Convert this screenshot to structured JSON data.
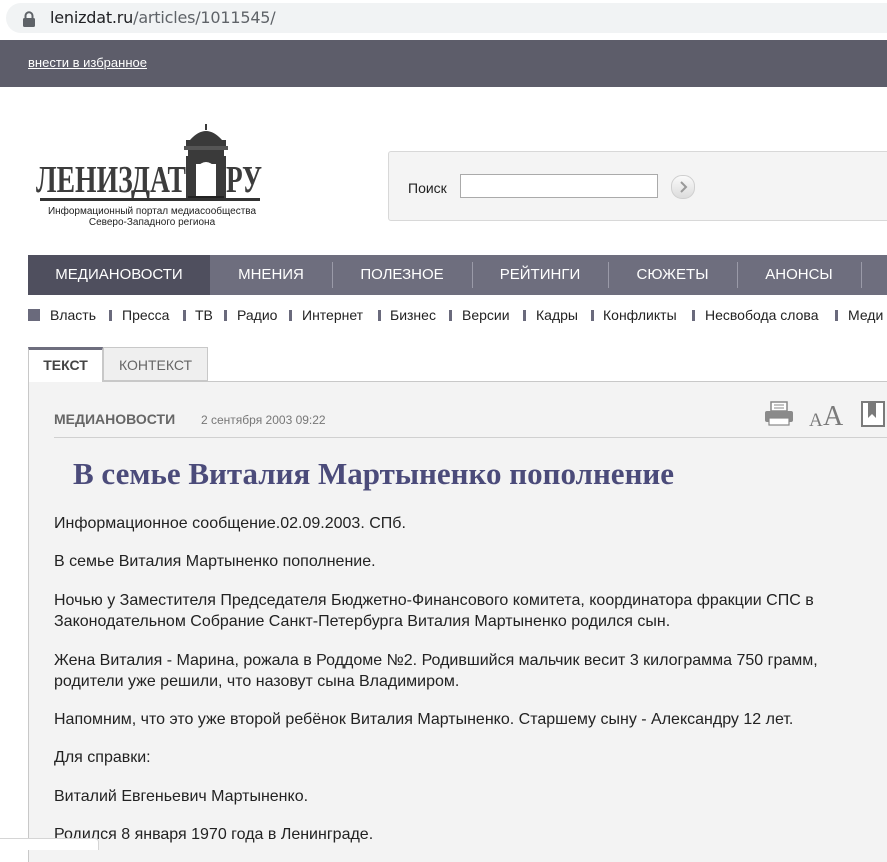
{
  "browser": {
    "url_host": "lenizdat.ru",
    "url_path": "/articles/1011545/"
  },
  "topbar": {
    "favorites_link": "внести в избранное"
  },
  "logo": {
    "text": "ЛЕНИЗДАТ",
    "suffix": "РУ",
    "tagline_line1": "Информационный портал медиасообщества",
    "tagline_line2": "Северо-Западного региона"
  },
  "search": {
    "label": "Поиск",
    "value": ""
  },
  "main_nav": [
    {
      "label": "МЕДИАНОВОСТИ"
    },
    {
      "label": "МНЕНИЯ"
    },
    {
      "label": "ПОЛЕЗНОЕ"
    },
    {
      "label": "РЕЙТИНГИ"
    },
    {
      "label": "СЮЖЕТЫ"
    },
    {
      "label": "АНОНСЫ"
    }
  ],
  "sub_nav": [
    {
      "label": "Власть"
    },
    {
      "label": "Пресса"
    },
    {
      "label": "ТВ"
    },
    {
      "label": "Радио"
    },
    {
      "label": "Интернет"
    },
    {
      "label": "Бизнес"
    },
    {
      "label": "Версии"
    },
    {
      "label": "Кадры"
    },
    {
      "label": "Конфликты"
    },
    {
      "label": "Несвобода слова"
    },
    {
      "label": "Меди"
    }
  ],
  "tabs": [
    {
      "label": "ТЕКСТ"
    },
    {
      "label": "КОНТЕКСТ"
    }
  ],
  "article": {
    "category": "МЕДИАНОВОСТИ",
    "date": "2 сентября 2003 09:22",
    "title": "В семье Виталия Мартыненко пополнение",
    "paragraphs": [
      "Информационное сообщение.02.09.2003. СПб.",
      "В семье Виталия Мартыненко пополнение.",
      "Ночью у Заместителя Председателя Бюджетно-Финансового комитета, координатора фракции СПС в Законодательном Собрание Санкт-Петербурга  Виталия Мартыненко родился сын.",
      "Жена Виталия -  Марина, рожала в Роддоме №2. Родившийся мальчик весит 3 килограмма 750 грамм, родители уже решили, что назовут сына Владимиром.",
      "Напомним, что это уже второй ребёнок Виталия Мартыненко. Старшему сыну - Александру 12 лет.",
      "Для справки:",
      "Виталий Евгеньевич Мартыненко.",
      "Родился 8 января 1970 года в Ленинграде."
    ]
  },
  "colors": {
    "topbar": "#5d5d6a",
    "nav": "#6e6e7e",
    "nav_active": "#4f4f5e",
    "headline": "#4b4b7a"
  }
}
